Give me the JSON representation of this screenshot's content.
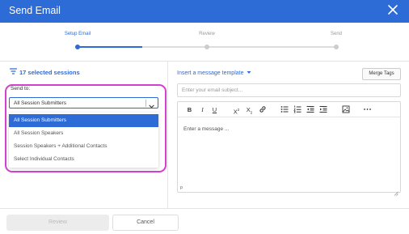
{
  "header": {
    "title": "Send Email"
  },
  "stepper": {
    "steps": [
      "Setup Email",
      "Review",
      "Send"
    ]
  },
  "sessions": {
    "label": "17 selected sessions"
  },
  "send_to": {
    "label": "Send to:",
    "selected": "All Session Submitters",
    "options": [
      "All Session Submitters",
      "All Session Speakers",
      "Session Speakers + Additional Contacts",
      "Select Individual Contacts"
    ]
  },
  "compose": {
    "template_label": "Insert a message template",
    "merge_tags_label": "Merge Tags",
    "subject_placeholder": "Enter your email subject...",
    "body_placeholder": "Enter a message ...",
    "path_label": "p"
  },
  "footer": {
    "review_label": "Review",
    "cancel_label": "Cancel"
  },
  "colors": {
    "accent": "#2d6bd6",
    "highlight": "#d43fd0"
  }
}
